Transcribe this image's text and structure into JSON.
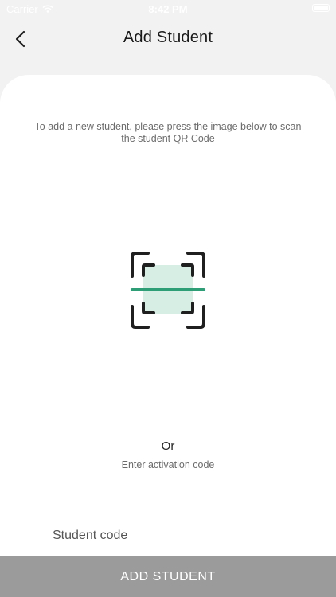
{
  "status_bar": {
    "carrier": "Carrier",
    "time": "8:42 PM",
    "icons": [
      "wifi-icon",
      "battery-icon"
    ]
  },
  "header": {
    "title": "Add Student",
    "back_icon": "chevron-left-icon"
  },
  "main": {
    "instructions": "To add a new student, please press the image below to scan the student QR Code",
    "scan_icon": "qr-scan-icon",
    "or_label": "Or",
    "activation_hint": "Enter activation code",
    "code_input": {
      "placeholder": "Student code",
      "value": ""
    },
    "submit_label": "ADD STUDENT"
  },
  "colors": {
    "background": "#f2f2f2",
    "card": "#ffffff",
    "scan_line": "#2e9e77",
    "scan_fill": "#d6eee4",
    "scan_corners": "#1f1f1f",
    "button": "#9b9b9b",
    "button_text": "#ffffff"
  }
}
